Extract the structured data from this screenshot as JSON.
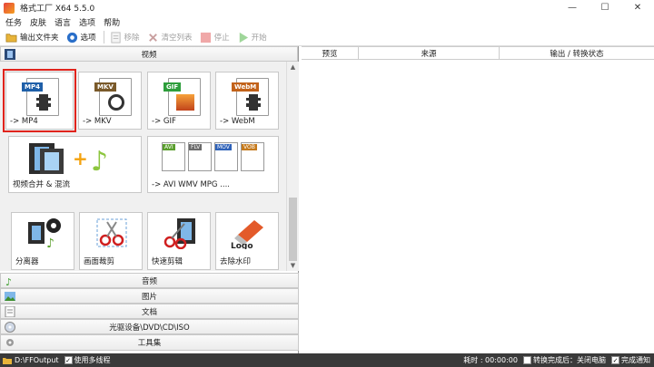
{
  "window": {
    "title": "格式工厂 X64 5.5.0",
    "minimize": "—",
    "maximize": "☐",
    "close": "✕"
  },
  "menu": [
    "任务",
    "皮肤",
    "语言",
    "选项",
    "帮助"
  ],
  "toolbar": {
    "output_folder": "输出文件夹",
    "options": "选项",
    "remove": "移除",
    "clear_list": "清空列表",
    "stop": "停止",
    "start": "开始"
  },
  "left": {
    "video_header": "视频",
    "tiles": [
      {
        "label": "-> MP4",
        "badge": "MP4",
        "badge_color": "#1f5fa8"
      },
      {
        "label": "-> MKV",
        "badge": "MKV",
        "badge_color": "#7a5a2a"
      },
      {
        "label": "-> GIF",
        "badge": "GIF",
        "badge_color": "#2e9e3c"
      },
      {
        "label": "-> WebM",
        "badge": "WebM",
        "badge_color": "#c2621a"
      }
    ],
    "merge_label": "视频合并 & 混流",
    "multi_label": "-> AVI WMV MPG ....",
    "multi_badges": [
      "AVI",
      "FLV",
      "MOV",
      "VOB"
    ],
    "tools": [
      "分离器",
      "画面裁剪",
      "快速剪辑",
      "去除水印"
    ],
    "logo_text": "Logo",
    "categories": [
      "音频",
      "图片",
      "文档",
      "光驱设备\\DVD\\CD\\ISO",
      "工具集"
    ]
  },
  "right": {
    "columns": [
      "预览",
      "来源",
      "输出 / 转换状态"
    ]
  },
  "status": {
    "output_path": "D:\\FFOutput",
    "multithread": "使用多线程",
    "elapsed": "耗时 : 00:00:00",
    "after_done": "转换完成后：关闭电脑",
    "notify": "完成通知",
    "checkmark": "✓"
  },
  "colors": {
    "selection": "#e0231c",
    "statusbar": "#3a3a3a"
  }
}
